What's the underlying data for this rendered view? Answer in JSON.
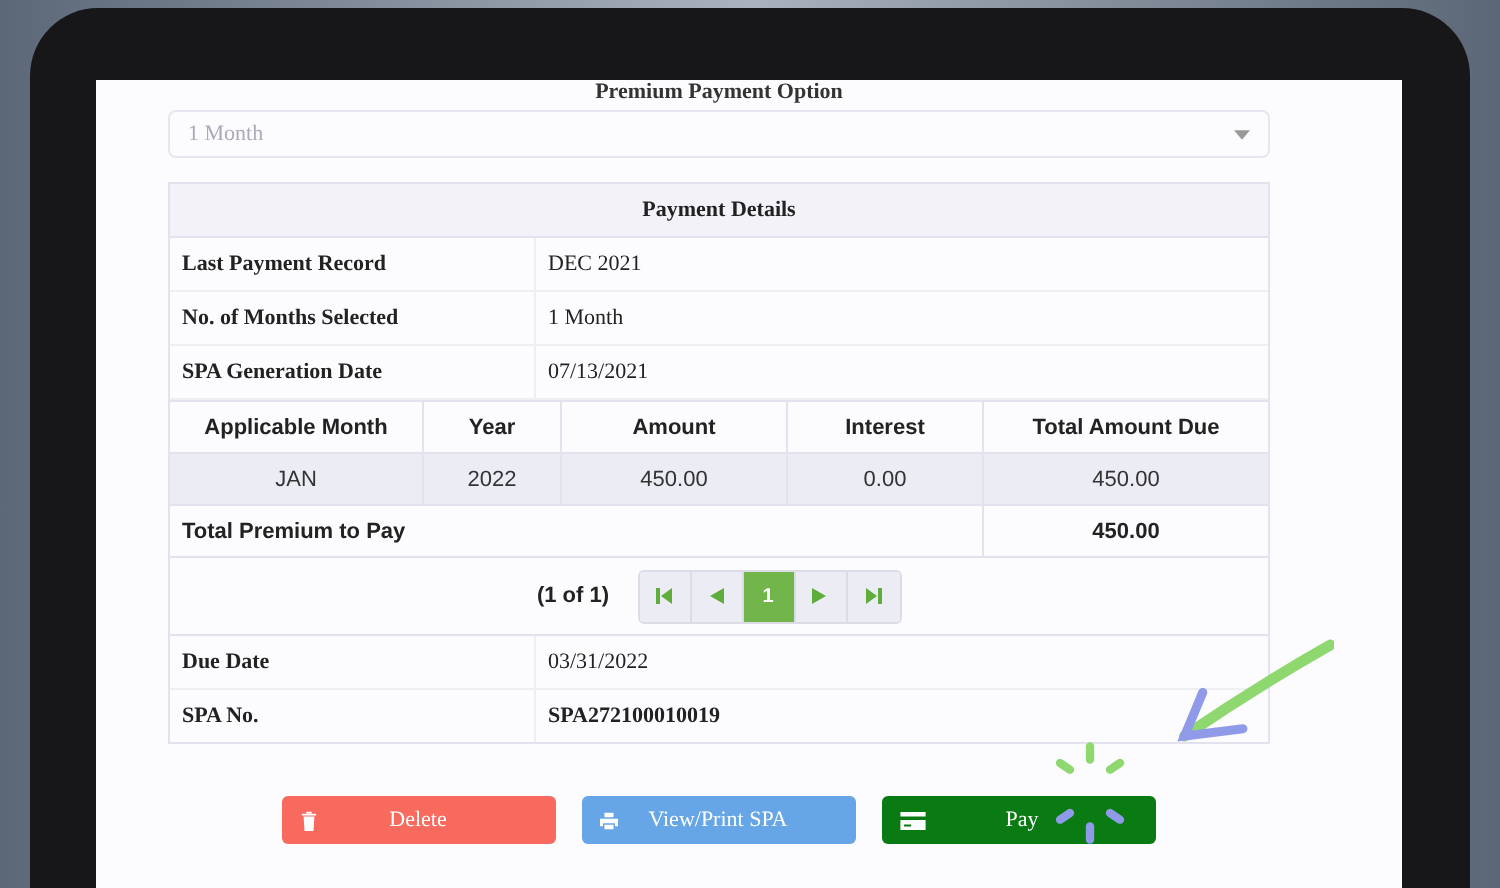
{
  "premium_option": {
    "title": "Premium Payment Option",
    "value": "1 Month"
  },
  "payment_details": {
    "title": "Payment Details",
    "rows": [
      {
        "label": "Last Payment Record",
        "value": "DEC 2021"
      },
      {
        "label": "No. of Months Selected",
        "value": "1 Month"
      },
      {
        "label": "SPA Generation Date",
        "value": "07/13/2021"
      }
    ]
  },
  "table": {
    "columns": [
      "Applicable Month",
      "Year",
      "Amount",
      "Interest",
      "Total Amount Due"
    ],
    "rows": [
      [
        "JAN",
        "2022",
        "450.00",
        "0.00",
        "450.00"
      ]
    ],
    "total": {
      "label": "Total Premium to Pay",
      "value": "450.00"
    }
  },
  "pagination": {
    "summary": "(1 of 1)",
    "pages": [
      {
        "label": "1",
        "selected": true
      }
    ]
  },
  "footer_rows": [
    {
      "label": "Due Date",
      "value": "03/31/2022",
      "bold": false
    },
    {
      "label": "SPA No.",
      "value": "SPA272100010019",
      "bold": true
    }
  ],
  "buttons": [
    {
      "kind": "delete",
      "label": "Delete"
    },
    {
      "kind": "print",
      "label": "View/Print SPA"
    },
    {
      "kind": "pay",
      "label": "Pay"
    }
  ]
}
